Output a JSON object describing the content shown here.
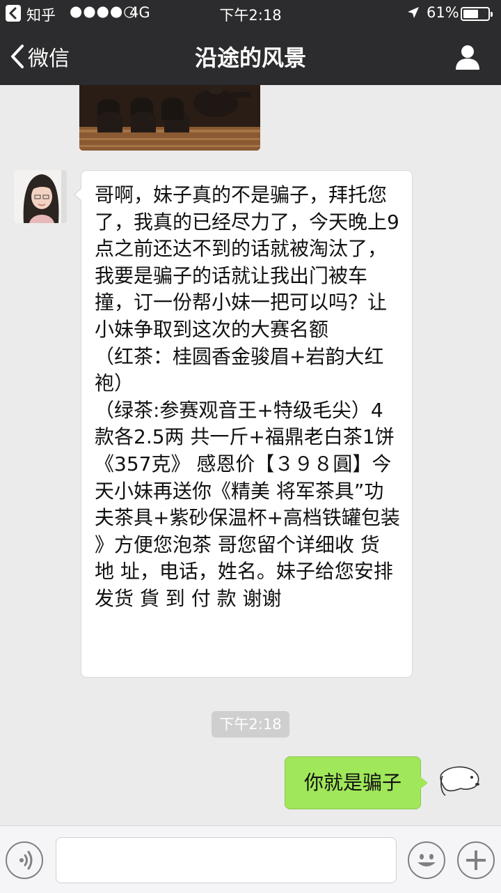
{
  "status_bar": {
    "app_name": "知乎",
    "signal": "●●●●○",
    "network": "4G",
    "time": "下午2:18",
    "location_icon": "location-arrow-icon",
    "battery_percent": "61%",
    "battery_level": 0.61
  },
  "nav": {
    "back_label": "微信",
    "title": "沿途的风景",
    "profile_icon": "person-icon"
  },
  "messages": [
    {
      "side": "left",
      "type": "image",
      "description_icon": "tea-set-image"
    },
    {
      "side": "left",
      "type": "text",
      "text": "哥啊，妹子真的不是骗子，拜托您了，我真的已经尽力了，今天晚上9点之前还达不到的话就被淘汰了，我要是骗子的话就让我出门被车撞，订一份帮小妹一把可以吗？让小妹争取到这次的大赛名额\n（红茶：桂圆香金骏眉+岩韵大红袍）\n（绿茶:参赛观音王+特级毛尖）4款各2.5两 共一斤+福鼎老白茶1饼《357克》 感恩价【３９８圓】今天小妹再送你《精美 将军茶具”功夫茶具+紫砂保温杯+高档铁罐包装 》方便您泡茶  哥您留个详细收 货 地 址，电话，姓名。妹子给您安排发货   貨 到 付 款   谢谢"
    },
    {
      "type": "timestamp",
      "text": "下午2:18"
    },
    {
      "side": "right",
      "type": "text",
      "text": "你就是骗子"
    }
  ],
  "input_bar": {
    "voice_icon": "voice-icon",
    "input_value": "",
    "emoji_icon": "emoji-icon",
    "plus_icon": "plus-icon"
  },
  "colors": {
    "nav_bg": "#2c2c2e",
    "chat_bg": "#ebebeb",
    "bubble_left": "#ffffff",
    "bubble_right": "#a0e75a",
    "timestamp_bg": "#cfcfcf"
  }
}
